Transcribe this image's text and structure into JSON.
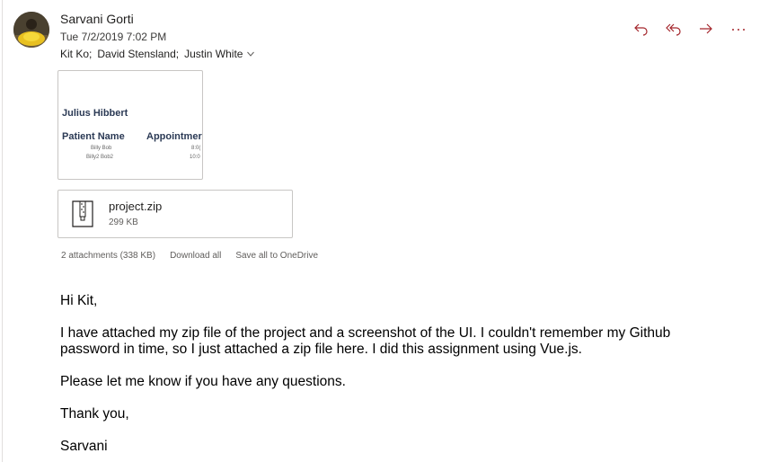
{
  "email": {
    "sender": "Sarvani Gorti",
    "date": "Tue 7/2/2019 7:02 PM",
    "recipients": [
      "Kit Ko;",
      "David Stensland;",
      "Justin White"
    ],
    "actions": [
      "reply-icon",
      "reply-all-icon",
      "forward-icon",
      "more-icon"
    ],
    "accent_color": "#a4262c"
  },
  "attachments": {
    "image_preview": {
      "title": "Julius Hibbert",
      "headers": [
        "Patient Name",
        "Appointmer"
      ],
      "rows": [
        {
          "name": "Billy Bob",
          "time": "8:0("
        },
        {
          "name": "Billy2 Bob2",
          "time": "10:0"
        }
      ]
    },
    "file": {
      "name": "project.zip",
      "size": "299 KB",
      "icon": "zip-file-icon"
    },
    "summary": "2 attachments (338 KB)",
    "download_all": "Download all",
    "save_onedrive": "Save all to OneDrive"
  },
  "body": {
    "greeting": "Hi Kit,",
    "paragraph1": "I have attached my zip file of the project and a screenshot of the UI. I couldn't remember my Github password in time, so I just attached a zip file here. I did this assignment using Vue.js.",
    "paragraph2": "Please let me know if you have any questions.",
    "closing": "Thank you,",
    "signature": "Sarvani"
  }
}
